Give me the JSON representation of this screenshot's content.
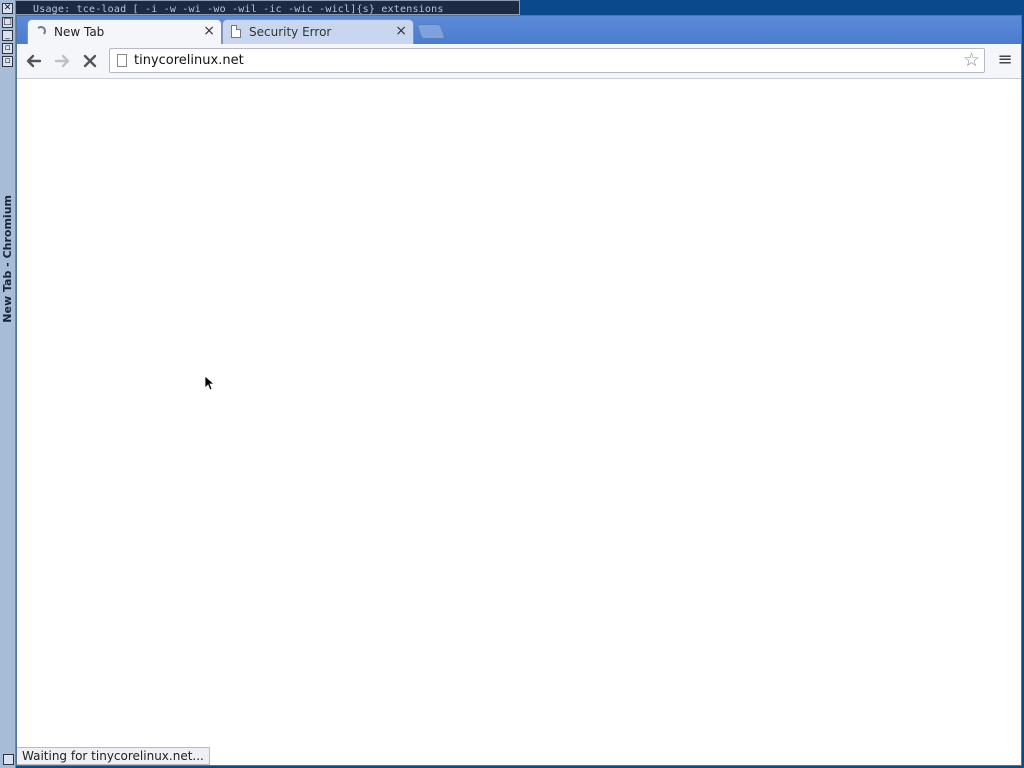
{
  "terminal": {
    "text": "Usage: tce-load [ -i -w -wi -wo -wil -ic -wic -wicl]{s} extensions"
  },
  "wm": {
    "title": "New Tab - Chromium"
  },
  "tabs": [
    {
      "label": "New Tab",
      "state": "loading",
      "close": "×"
    },
    {
      "label": "Security Error",
      "state": "idle",
      "close": "×"
    }
  ],
  "toolbar": {
    "back_glyph": "🡐",
    "forward_glyph": "🡒",
    "stop_glyph": "✕",
    "url": "tinycorelinux.net",
    "star_glyph": "☆",
    "menu_glyph": "≡"
  },
  "status": {
    "text": "Waiting for tinycorelinux.net..."
  },
  "colors": {
    "tabstrip": "#4a7cd0",
    "desktop": "#0a4a8c"
  }
}
